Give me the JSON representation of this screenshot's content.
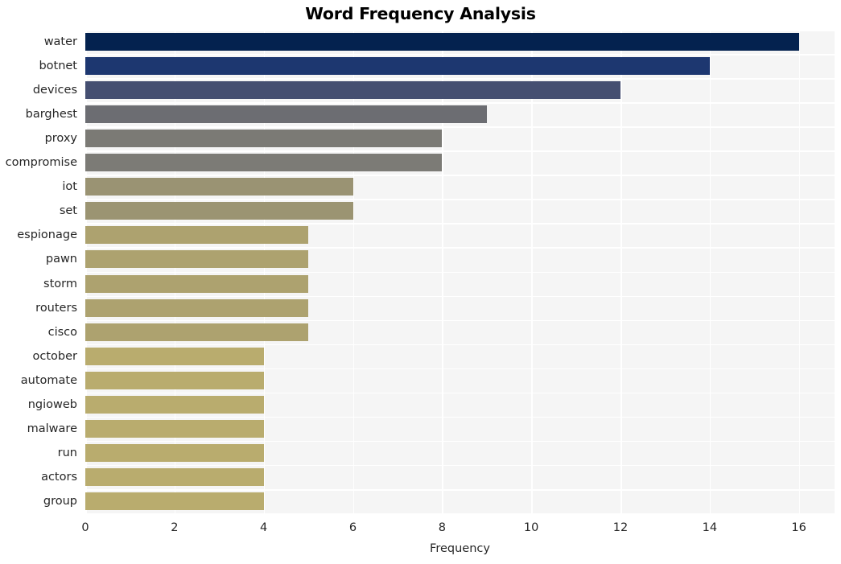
{
  "chart_data": {
    "type": "bar",
    "orientation": "horizontal",
    "title": "Word Frequency Analysis",
    "xlabel": "Frequency",
    "ylabel": "",
    "xlim": [
      0,
      16.8
    ],
    "xticks": [
      0,
      2,
      4,
      6,
      8,
      10,
      12,
      14,
      16
    ],
    "xtick_labels": [
      "0",
      "2",
      "4",
      "6",
      "8",
      "10",
      "12",
      "14",
      "16"
    ],
    "grid": true,
    "legend": "none",
    "background": "#f5f5f5",
    "gridline_color": "#ffffff",
    "categories": [
      "water",
      "botnet",
      "devices",
      "barghest",
      "proxy",
      "compromise",
      "iot",
      "set",
      "espionage",
      "pawn",
      "storm",
      "routers",
      "cisco",
      "october",
      "automate",
      "ngioweb",
      "malware",
      "run",
      "actors",
      "group"
    ],
    "values": [
      16,
      14,
      12,
      9,
      8,
      8,
      6,
      6,
      5,
      5,
      5,
      5,
      5,
      4,
      4,
      4,
      4,
      4,
      4,
      4
    ],
    "bar_colors": [
      "#04224f",
      "#1d3770",
      "#454f71",
      "#6c6d72",
      "#7b7a75",
      "#7c7b76",
      "#9a9373",
      "#9b9472",
      "#ada26f",
      "#ada26f",
      "#ada26f",
      "#ada26f",
      "#ada26f",
      "#b9ac6e",
      "#b9ac6e",
      "#b9ac6e",
      "#b9ac6e",
      "#b9ac6e",
      "#b9ac6e",
      "#b9ac6e"
    ]
  }
}
